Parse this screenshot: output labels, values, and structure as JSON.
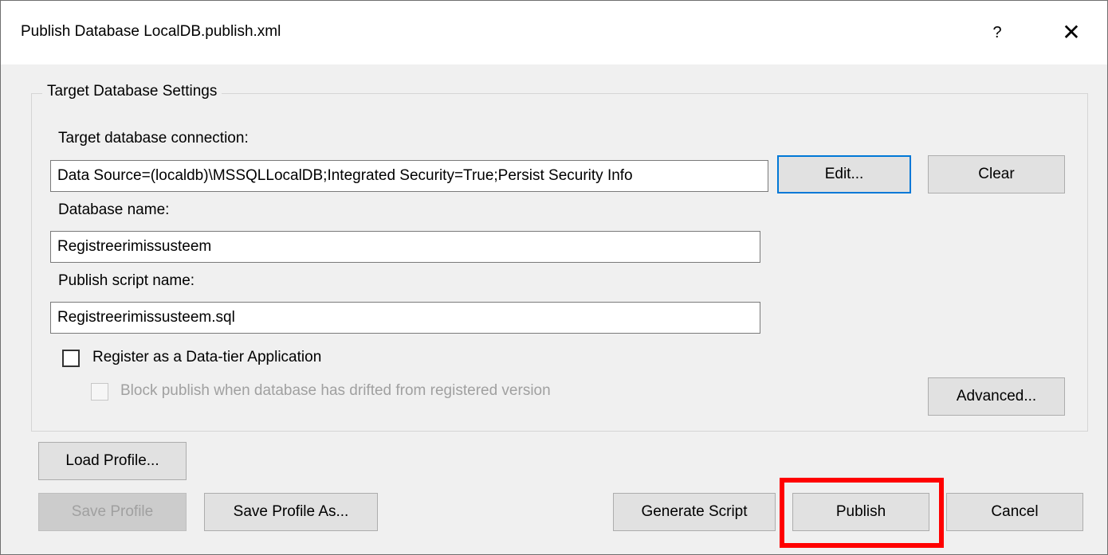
{
  "dialog": {
    "title": "Publish Database LocalDB.publish.xml",
    "help_glyph": "?",
    "close_glyph": "✕"
  },
  "group": {
    "legend": "Target Database Settings",
    "connection_label": "Target database connection:",
    "connection_value": "Data Source=(localdb)\\MSSQLLocalDB;Integrated Security=True;Persist Security Info",
    "edit_label": "Edit...",
    "clear_label": "Clear",
    "dbname_label": "Database name:",
    "dbname_value": "Registreerimissusteem",
    "script_label": "Publish script name:",
    "script_value": "Registreerimissusteem.sql",
    "register_label": "Register as a Data-tier Application",
    "register_checked": false,
    "block_label": "Block publish when database has drifted from registered version",
    "block_checked": false,
    "block_enabled": false,
    "advanced_label": "Advanced..."
  },
  "footer": {
    "load_profile": "Load Profile...",
    "save_profile": "Save Profile",
    "save_profile_as": "Save Profile As...",
    "generate_script": "Generate Script",
    "publish": "Publish",
    "cancel": "Cancel"
  },
  "colors": {
    "focus_border": "#0078d7",
    "highlight": "#ff0000",
    "dialog_bg": "#f0f0f0"
  }
}
